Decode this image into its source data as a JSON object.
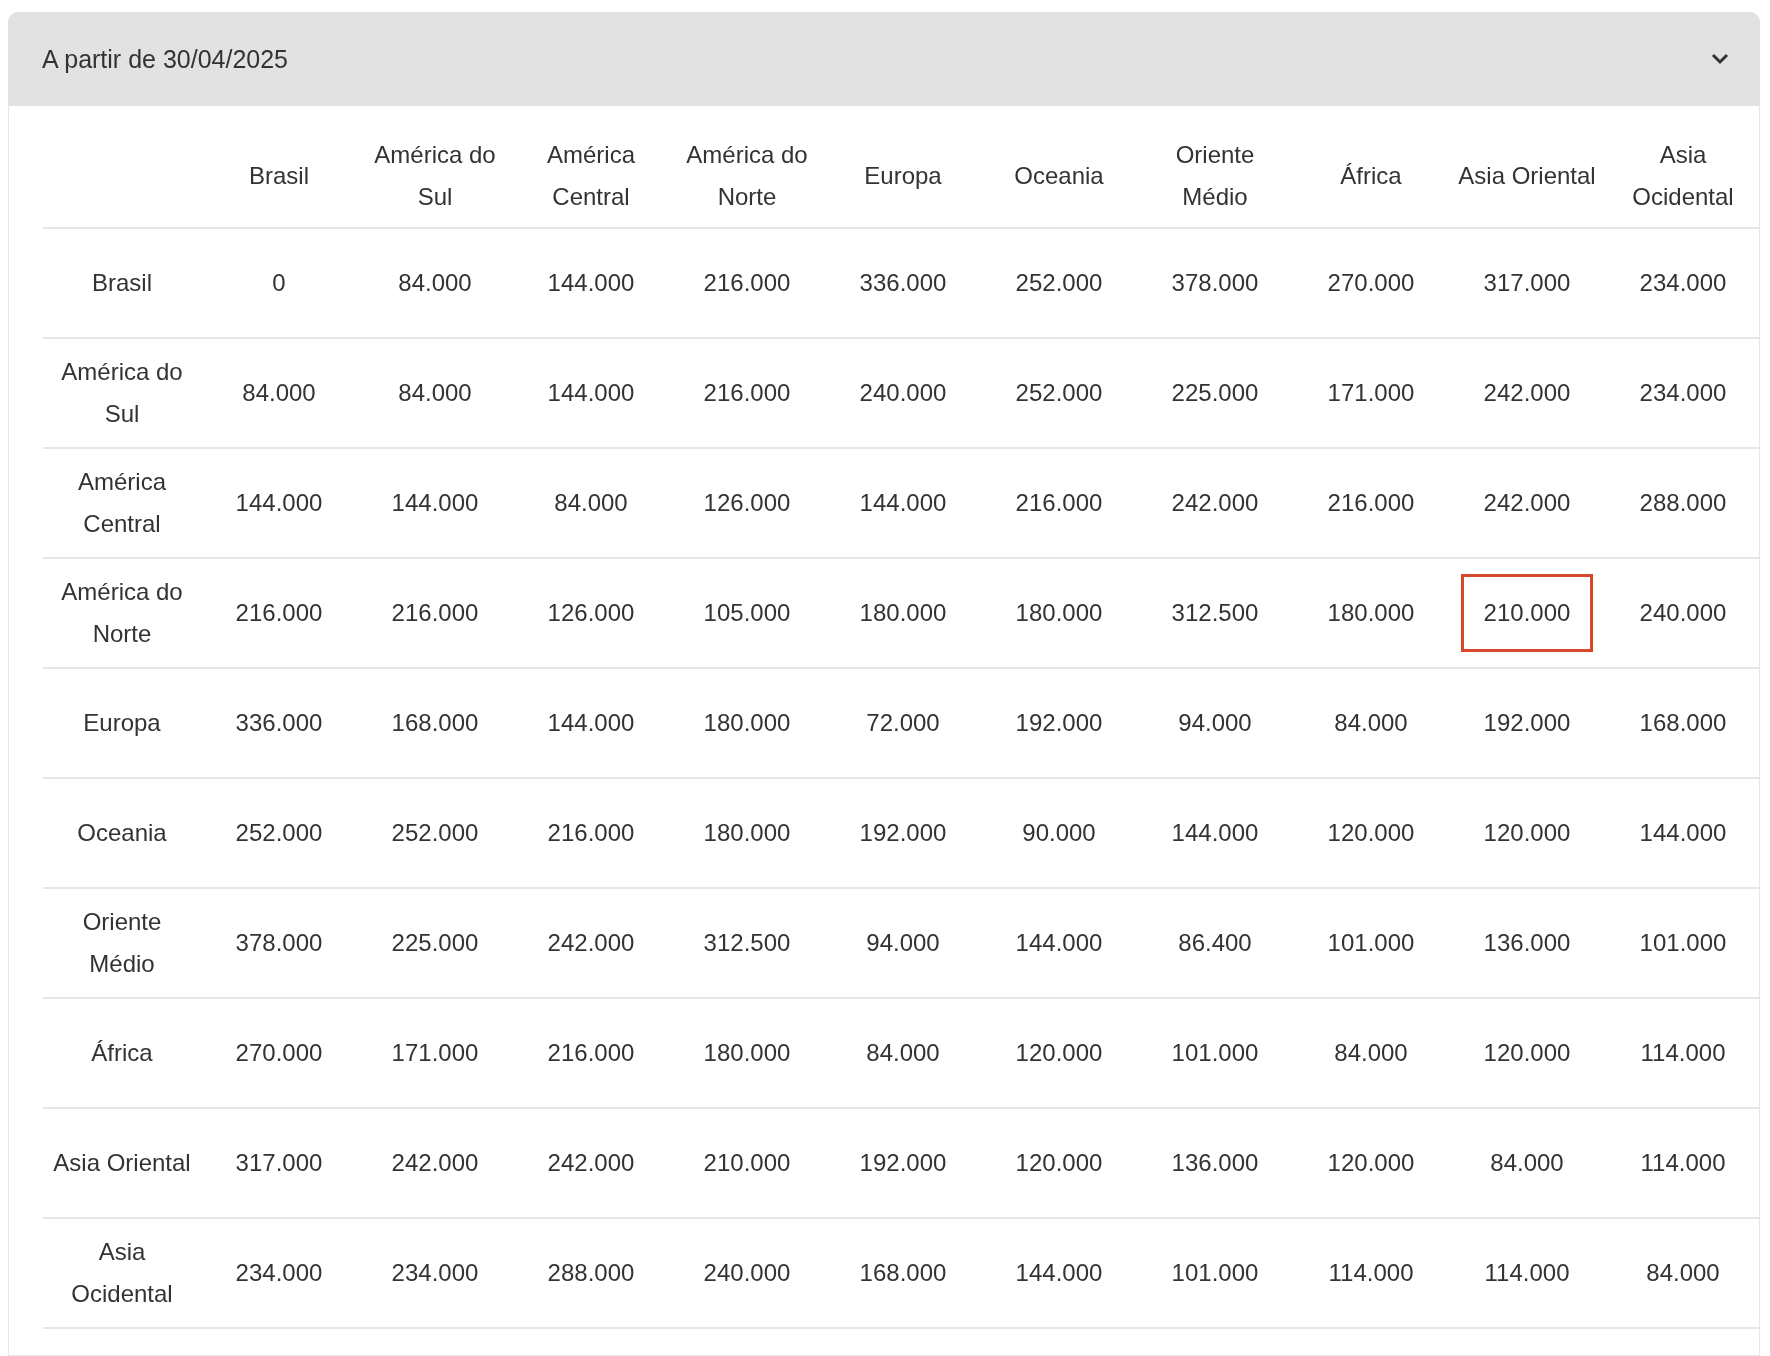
{
  "accordion": {
    "title": "A partir de 30/04/2025",
    "expanded": true
  },
  "table": {
    "columns": [
      "Brasil",
      "América do Sul",
      "América Central",
      "América do Norte",
      "Europa",
      "Oceania",
      "Oriente Médio",
      "África",
      "Asia Oriental",
      "Asia Ocidental"
    ],
    "rows": [
      {
        "label": "Brasil",
        "cells": [
          {
            "value": "0",
            "highlighted": false
          },
          {
            "value": "84.000",
            "highlighted": false
          },
          {
            "value": "144.000",
            "highlighted": false
          },
          {
            "value": "216.000",
            "highlighted": false
          },
          {
            "value": "336.000",
            "highlighted": false
          },
          {
            "value": "252.000",
            "highlighted": false
          },
          {
            "value": "378.000",
            "highlighted": false
          },
          {
            "value": "270.000",
            "highlighted": false
          },
          {
            "value": "317.000",
            "highlighted": false
          },
          {
            "value": "234.000",
            "highlighted": false
          }
        ]
      },
      {
        "label": "América do Sul",
        "cells": [
          {
            "value": "84.000",
            "highlighted": false
          },
          {
            "value": "84.000",
            "highlighted": false
          },
          {
            "value": "144.000",
            "highlighted": false
          },
          {
            "value": "216.000",
            "highlighted": false
          },
          {
            "value": "240.000",
            "highlighted": false
          },
          {
            "value": "252.000",
            "highlighted": false
          },
          {
            "value": "225.000",
            "highlighted": false
          },
          {
            "value": "171.000",
            "highlighted": false
          },
          {
            "value": "242.000",
            "highlighted": false
          },
          {
            "value": "234.000",
            "highlighted": false
          }
        ]
      },
      {
        "label": "América Central",
        "cells": [
          {
            "value": "144.000",
            "highlighted": false
          },
          {
            "value": "144.000",
            "highlighted": false
          },
          {
            "value": "84.000",
            "highlighted": false
          },
          {
            "value": "126.000",
            "highlighted": false
          },
          {
            "value": "144.000",
            "highlighted": false
          },
          {
            "value": "216.000",
            "highlighted": false
          },
          {
            "value": "242.000",
            "highlighted": false
          },
          {
            "value": "216.000",
            "highlighted": false
          },
          {
            "value": "242.000",
            "highlighted": false
          },
          {
            "value": "288.000",
            "highlighted": false
          }
        ]
      },
      {
        "label": "América do Norte",
        "cells": [
          {
            "value": "216.000",
            "highlighted": false
          },
          {
            "value": "216.000",
            "highlighted": false
          },
          {
            "value": "126.000",
            "highlighted": false
          },
          {
            "value": "105.000",
            "highlighted": false
          },
          {
            "value": "180.000",
            "highlighted": false
          },
          {
            "value": "180.000",
            "highlighted": false
          },
          {
            "value": "312.500",
            "highlighted": false
          },
          {
            "value": "180.000",
            "highlighted": false
          },
          {
            "value": "210.000",
            "highlighted": true
          },
          {
            "value": "240.000",
            "highlighted": false
          }
        ]
      },
      {
        "label": "Europa",
        "cells": [
          {
            "value": "336.000",
            "highlighted": false
          },
          {
            "value": "168.000",
            "highlighted": false
          },
          {
            "value": "144.000",
            "highlighted": false
          },
          {
            "value": "180.000",
            "highlighted": false
          },
          {
            "value": "72.000",
            "highlighted": false
          },
          {
            "value": "192.000",
            "highlighted": false
          },
          {
            "value": "94.000",
            "highlighted": false
          },
          {
            "value": "84.000",
            "highlighted": false
          },
          {
            "value": "192.000",
            "highlighted": false
          },
          {
            "value": "168.000",
            "highlighted": false
          }
        ]
      },
      {
        "label": "Oceania",
        "cells": [
          {
            "value": "252.000",
            "highlighted": false
          },
          {
            "value": "252.000",
            "highlighted": false
          },
          {
            "value": "216.000",
            "highlighted": false
          },
          {
            "value": "180.000",
            "highlighted": false
          },
          {
            "value": "192.000",
            "highlighted": false
          },
          {
            "value": "90.000",
            "highlighted": false
          },
          {
            "value": "144.000",
            "highlighted": false
          },
          {
            "value": "120.000",
            "highlighted": false
          },
          {
            "value": "120.000",
            "highlighted": false
          },
          {
            "value": "144.000",
            "highlighted": false
          }
        ]
      },
      {
        "label": "Oriente Médio",
        "cells": [
          {
            "value": "378.000",
            "highlighted": false
          },
          {
            "value": "225.000",
            "highlighted": false
          },
          {
            "value": "242.000",
            "highlighted": false
          },
          {
            "value": "312.500",
            "highlighted": false
          },
          {
            "value": "94.000",
            "highlighted": false
          },
          {
            "value": "144.000",
            "highlighted": false
          },
          {
            "value": "86.400",
            "highlighted": false
          },
          {
            "value": "101.000",
            "highlighted": false
          },
          {
            "value": "136.000",
            "highlighted": false
          },
          {
            "value": "101.000",
            "highlighted": false
          }
        ]
      },
      {
        "label": "África",
        "cells": [
          {
            "value": "270.000",
            "highlighted": false
          },
          {
            "value": "171.000",
            "highlighted": false
          },
          {
            "value": "216.000",
            "highlighted": false
          },
          {
            "value": "180.000",
            "highlighted": false
          },
          {
            "value": "84.000",
            "highlighted": false
          },
          {
            "value": "120.000",
            "highlighted": false
          },
          {
            "value": "101.000",
            "highlighted": false
          },
          {
            "value": "84.000",
            "highlighted": false
          },
          {
            "value": "120.000",
            "highlighted": false
          },
          {
            "value": "114.000",
            "highlighted": false
          }
        ]
      },
      {
        "label": "Asia Oriental",
        "cells": [
          {
            "value": "317.000",
            "highlighted": false
          },
          {
            "value": "242.000",
            "highlighted": false
          },
          {
            "value": "242.000",
            "highlighted": false
          },
          {
            "value": "210.000",
            "highlighted": false
          },
          {
            "value": "192.000",
            "highlighted": false
          },
          {
            "value": "120.000",
            "highlighted": false
          },
          {
            "value": "136.000",
            "highlighted": false
          },
          {
            "value": "120.000",
            "highlighted": false
          },
          {
            "value": "84.000",
            "highlighted": false
          },
          {
            "value": "114.000",
            "highlighted": false
          }
        ]
      },
      {
        "label": "Asia Ocidental",
        "cells": [
          {
            "value": "234.000",
            "highlighted": false
          },
          {
            "value": "234.000",
            "highlighted": false
          },
          {
            "value": "288.000",
            "highlighted": false
          },
          {
            "value": "240.000",
            "highlighted": false
          },
          {
            "value": "168.000",
            "highlighted": false
          },
          {
            "value": "144.000",
            "highlighted": false
          },
          {
            "value": "101.000",
            "highlighted": false
          },
          {
            "value": "114.000",
            "highlighted": false
          },
          {
            "value": "114.000",
            "highlighted": false
          },
          {
            "value": "84.000",
            "highlighted": false
          }
        ]
      }
    ]
  }
}
